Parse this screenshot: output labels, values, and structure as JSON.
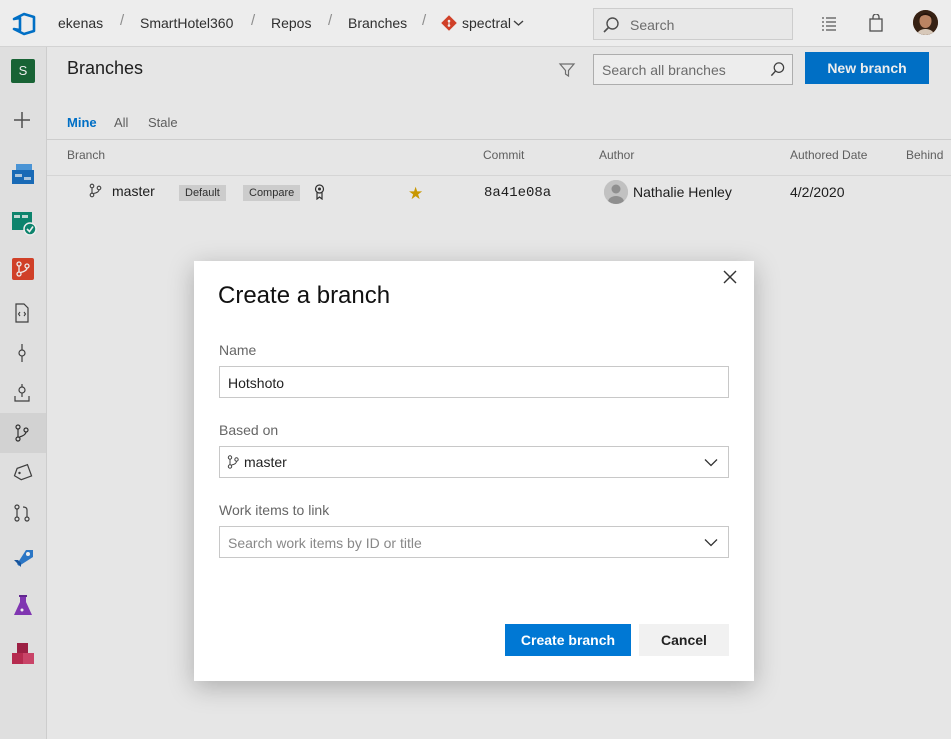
{
  "topbar": {
    "org": "ekenas",
    "project": "SmartHotel360",
    "section": "Repos",
    "page": "Branches",
    "repo": "spectral",
    "search_placeholder": "Search",
    "separator": "/"
  },
  "leftnav": {
    "project_initial": "S",
    "active_item": "branches-icon"
  },
  "page": {
    "title": "Branches",
    "search_placeholder": "Search all branches",
    "new_branch_label": "New branch",
    "tabs": [
      {
        "label": "Mine",
        "active": true
      },
      {
        "label": "All",
        "active": false
      },
      {
        "label": "Stale",
        "active": false
      }
    ],
    "columns": {
      "branch": "Branch",
      "commit": "Commit",
      "author": "Author",
      "authored_date": "Authored Date",
      "behind": "Behind"
    },
    "rows": [
      {
        "branch": "master",
        "default_label": "Default",
        "compare_label": "Compare",
        "favorite": true,
        "commit": "8a41e08a",
        "author": "Nathalie Henley",
        "date": "4/2/2020"
      }
    ]
  },
  "dialog": {
    "title": "Create a branch",
    "name_label": "Name",
    "name_value": "Hotshoto",
    "based_on_label": "Based on",
    "based_on_value": "master",
    "work_items_label": "Work items to link",
    "work_items_placeholder": "Search work items by ID or title",
    "create_label": "Create branch",
    "cancel_label": "Cancel"
  },
  "colors": {
    "accent": "#0078d4",
    "star": "#d8a300",
    "repo_icon": "#e0452c"
  }
}
